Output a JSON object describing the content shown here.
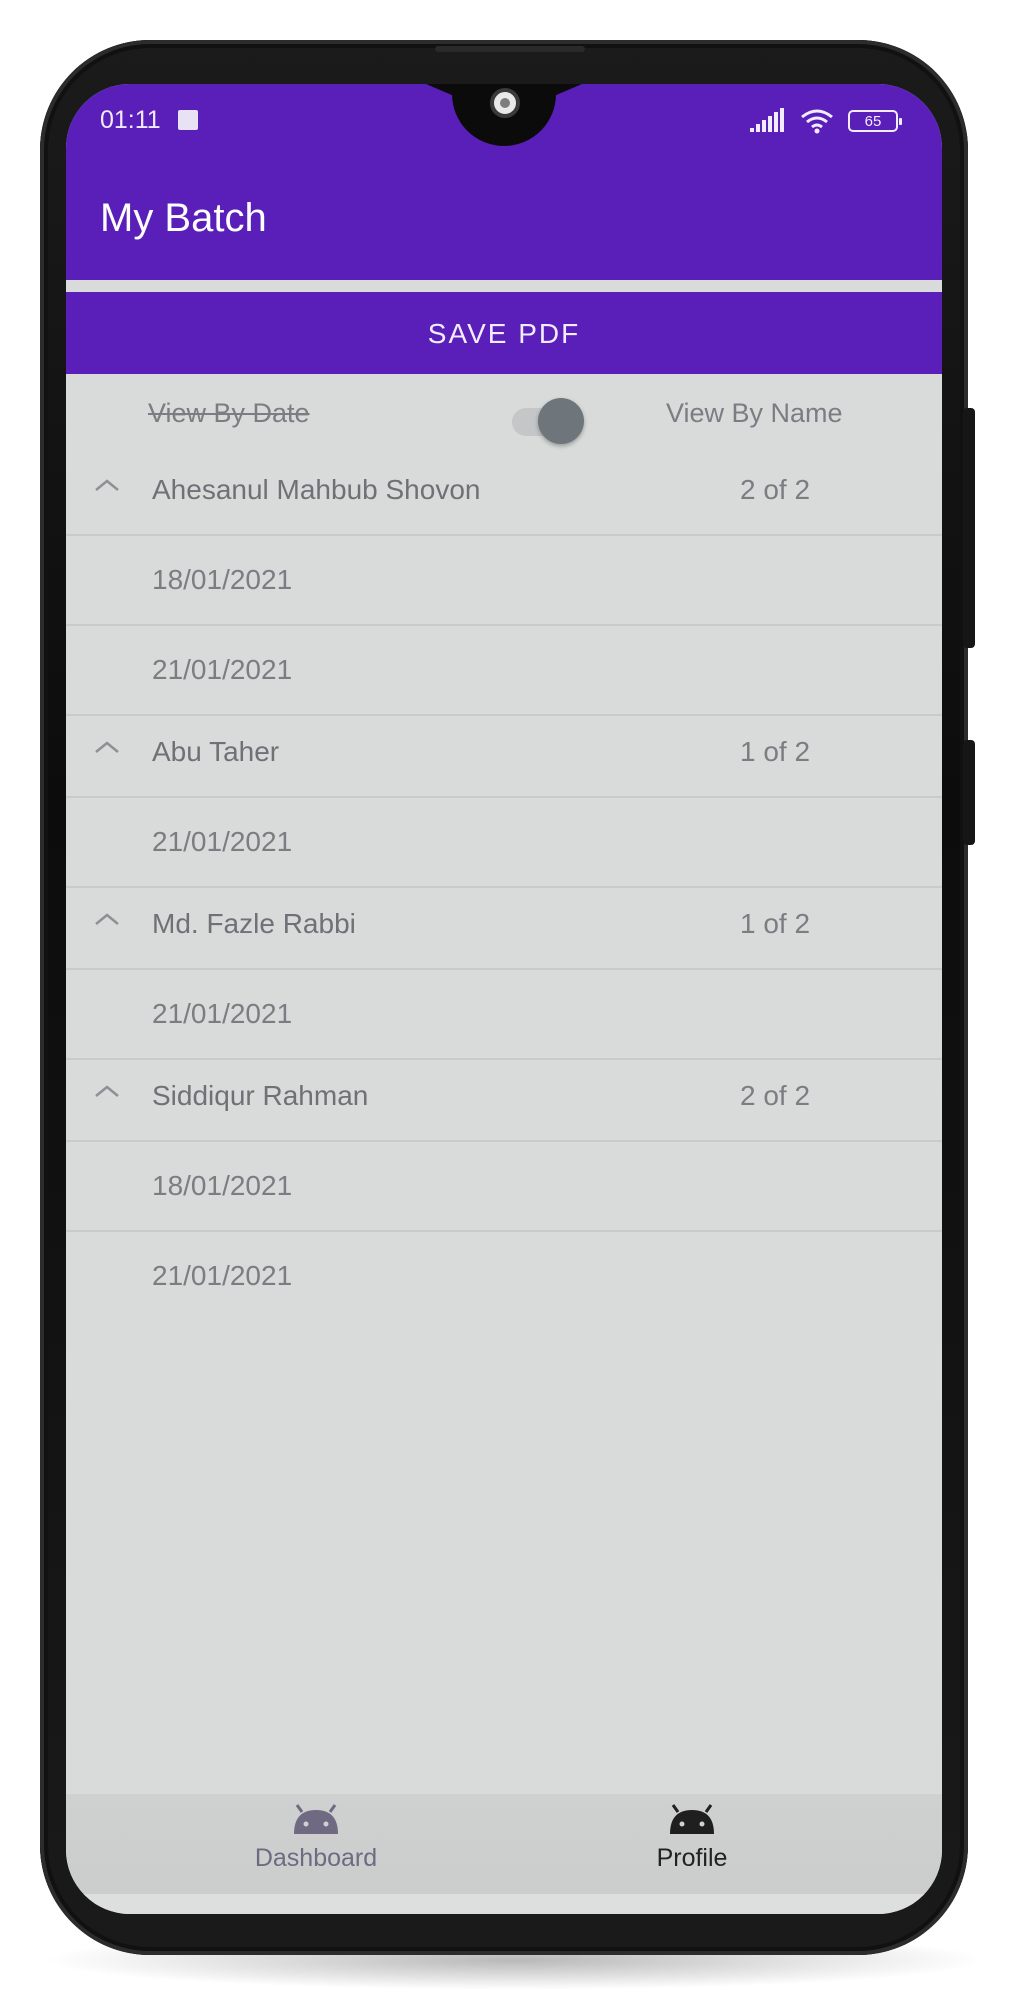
{
  "status_bar": {
    "time": "01:11",
    "battery": "65",
    "icons": [
      "sd-card-icon",
      "signal-icon",
      "wifi-icon",
      "battery-icon"
    ]
  },
  "app_bar": {
    "title": "My Batch"
  },
  "save_button": {
    "label": "SAVE PDF"
  },
  "view_toggle": {
    "left_label": "View By Date",
    "right_label": "View By Name",
    "state": "on"
  },
  "groups": [
    {
      "name": "Ahesanul Mahbub Shovon",
      "count": "2 of 2",
      "dates": [
        "18/01/2021",
        "21/01/2021"
      ]
    },
    {
      "name": "Abu Taher",
      "count": "1 of 2",
      "dates": [
        "21/01/2021"
      ]
    },
    {
      "name": "Md. Fazle Rabbi",
      "count": "1 of 2",
      "dates": [
        "21/01/2021"
      ]
    },
    {
      "name": "Siddiqur Rahman",
      "count": "2 of 2",
      "dates": [
        "18/01/2021",
        "21/01/2021"
      ]
    }
  ],
  "bottom_nav": {
    "items": [
      {
        "label": "Dashboard",
        "icon": "android-icon",
        "selected": false
      },
      {
        "label": "Profile",
        "icon": "android-icon",
        "selected": true
      }
    ]
  },
  "colors": {
    "primary": "#5a1fb9",
    "background": "#d9dada",
    "text_muted": "#7a7e82"
  }
}
